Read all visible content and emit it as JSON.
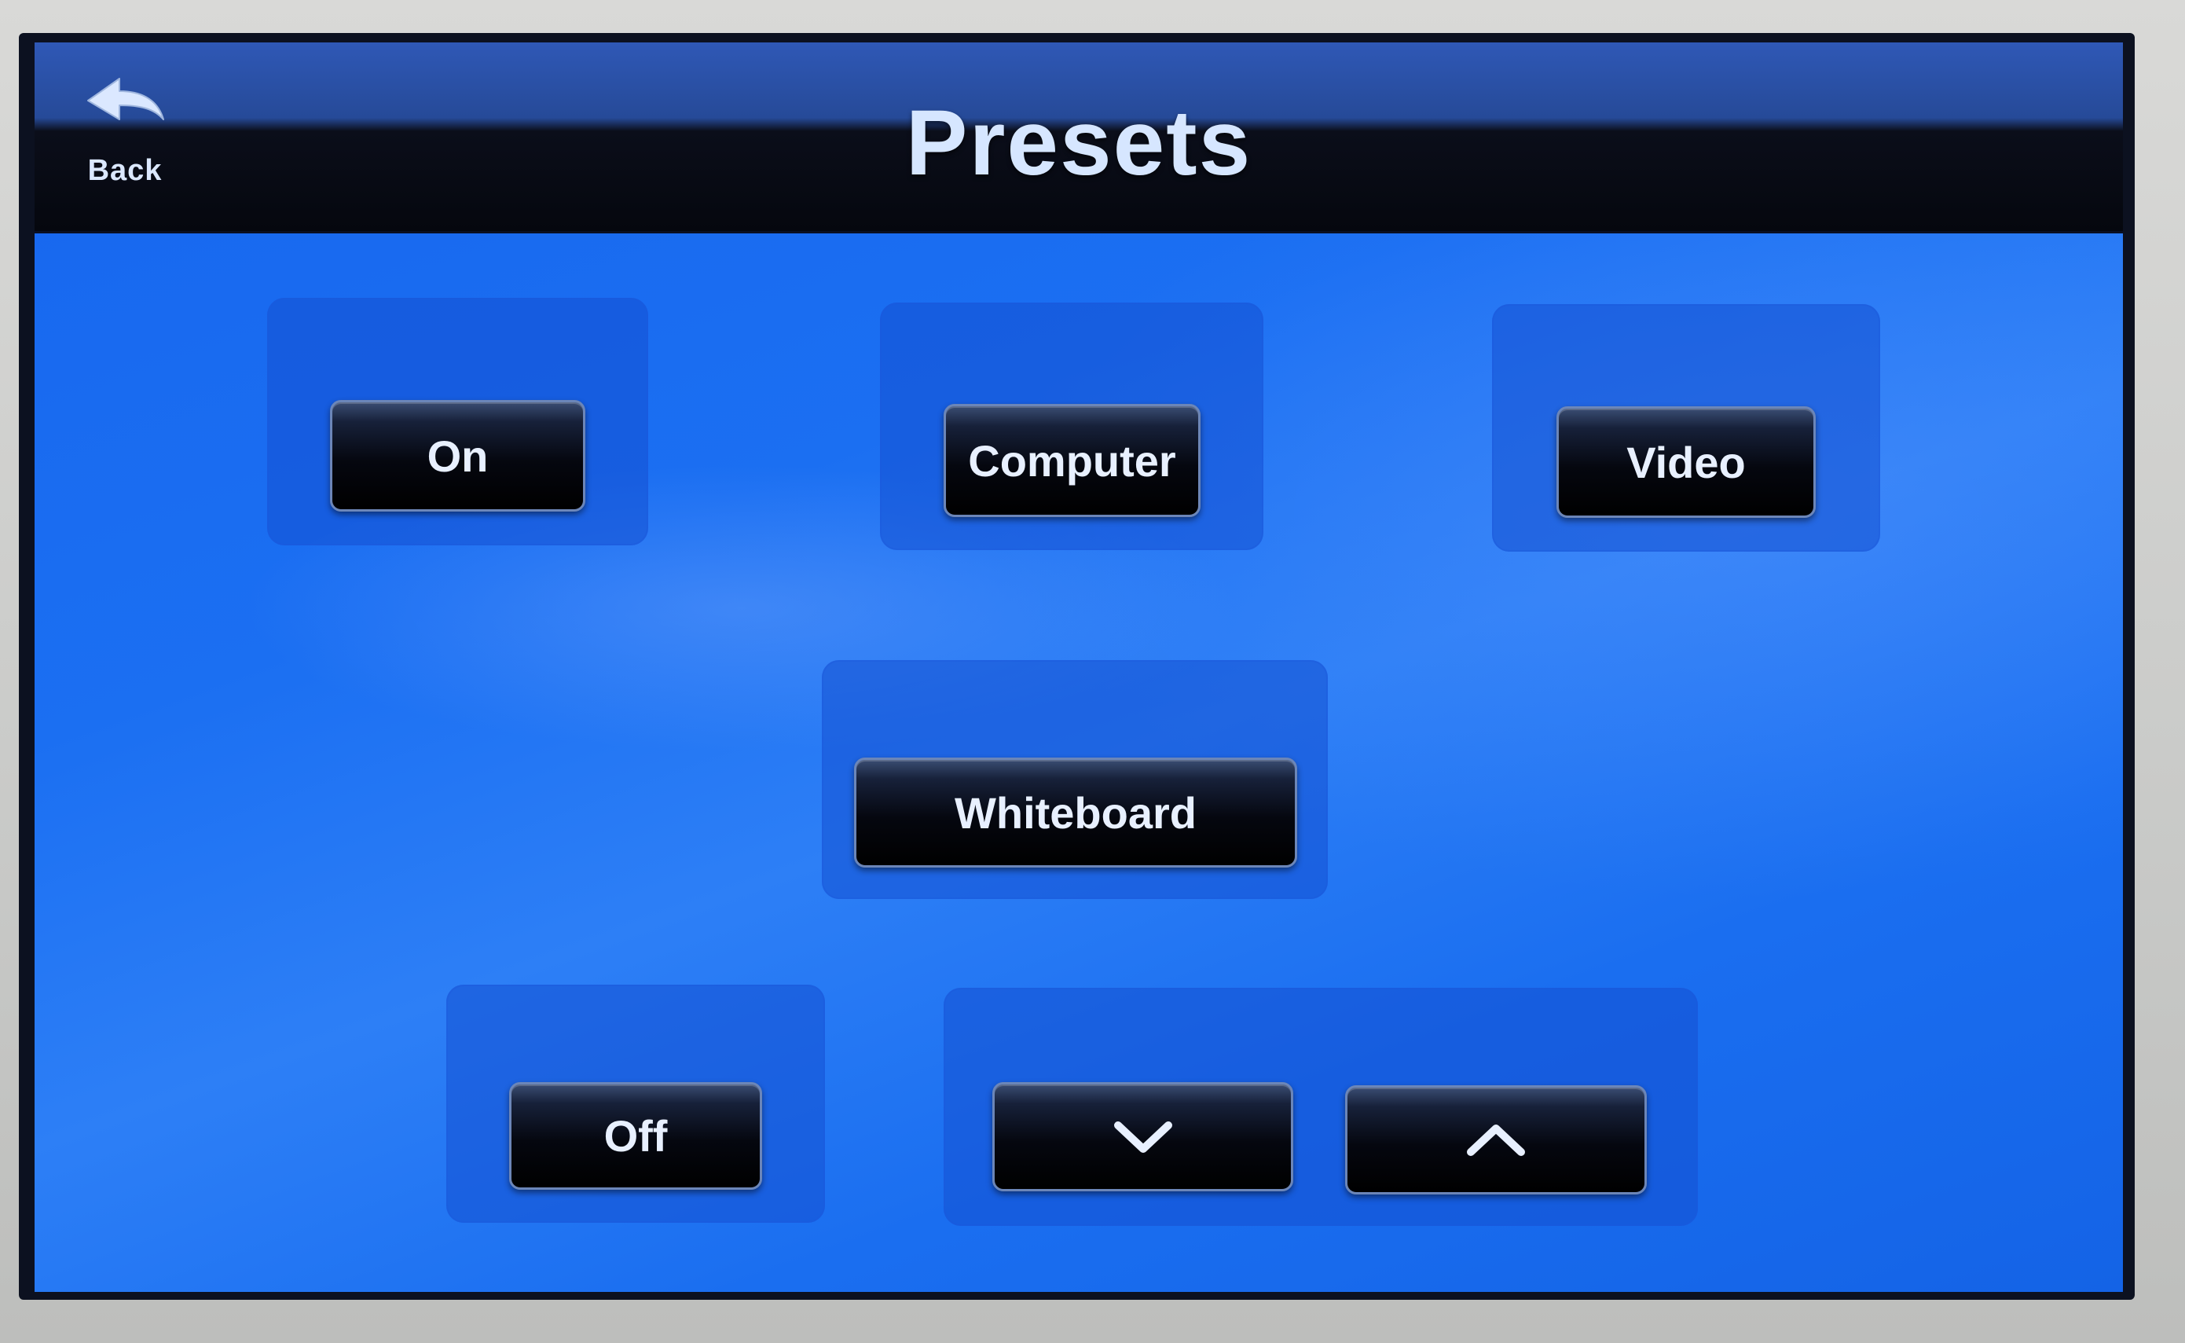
{
  "header": {
    "title": "Presets",
    "back_label": "Back"
  },
  "presets": {
    "on_label": "On",
    "computer_label": "Computer",
    "video_label": "Video",
    "whiteboard_label": "Whiteboard",
    "off_label": "Off"
  },
  "icons": {
    "back": "back-arrow-icon",
    "down": "chevron-down-icon",
    "up": "chevron-up-icon"
  },
  "colors": {
    "background_blue": "#1b6ff2",
    "header_dark": "#05070e",
    "button_black": "#05070f",
    "text_light": "#e8f0ff"
  }
}
